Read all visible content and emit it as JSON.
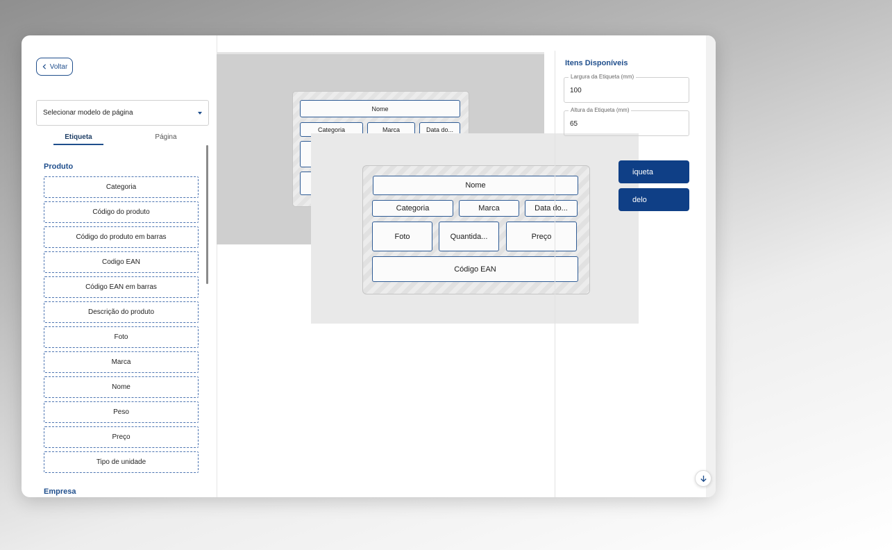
{
  "back_button": {
    "label": "Voltar"
  },
  "page_model_select": {
    "value": "Selecionar modelo de página"
  },
  "tabs": [
    {
      "label": "Etiqueta",
      "active": true
    },
    {
      "label": "Página",
      "active": false
    }
  ],
  "sections": {
    "produto": {
      "title": "Produto",
      "items": [
        "Categoria",
        "Código do produto",
        "Código do produto em barras",
        "Codigo EAN",
        "Código EAN em barras",
        "Descrição do produto",
        "Foto",
        "Marca",
        "Nome",
        "Peso",
        "Preço",
        "Tipo de unidade"
      ]
    },
    "empresa": {
      "title": "Empresa"
    }
  },
  "label_small": {
    "nome": "Nome",
    "categoria": "Categoria",
    "marca": "Marca",
    "data": "Data do..."
  },
  "label_big": {
    "nome": "Nome",
    "categoria": "Categoria",
    "marca": "Marca",
    "data": "Data do...",
    "foto": "Foto",
    "quantidade": "Quantida...",
    "preco": "Preço",
    "codigo_ean": "Código EAN"
  },
  "right_panel": {
    "title": "Itens Disponíveis",
    "largura": {
      "legend": "Largura da Etiqueta (mm)",
      "value": "100"
    },
    "altura": {
      "legend": "Altura da Etiqueta (mm)",
      "value": "65"
    },
    "button1_label": "iqueta",
    "button2_label": "delo"
  },
  "colors": {
    "primary": "#0f3f86",
    "accent": "#1f4e8c",
    "dashed_border": "#4a73b0"
  },
  "icons": {
    "back": "chevron-left-icon",
    "dropdown": "caret-down-icon",
    "scroll": "arrow-down-icon"
  }
}
